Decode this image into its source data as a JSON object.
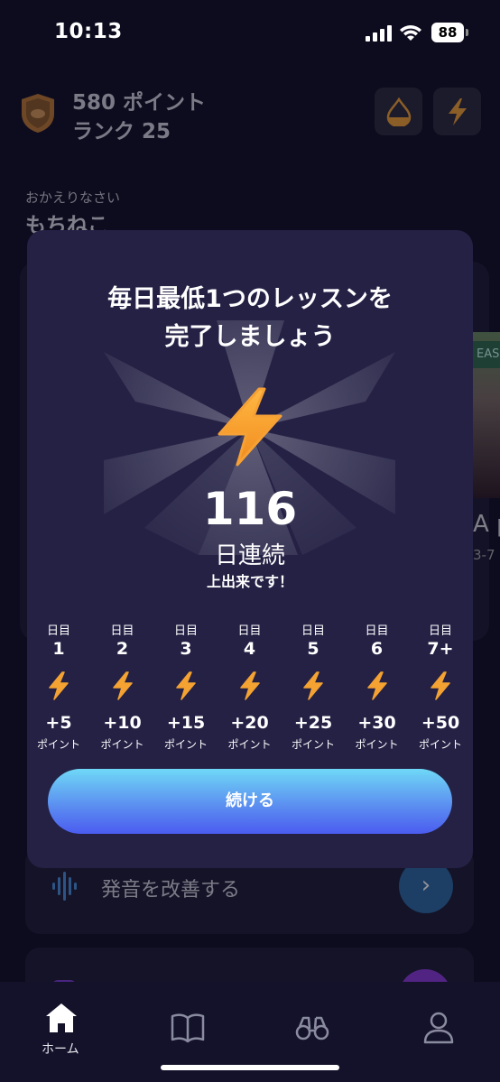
{
  "status_bar": {
    "time": "10:13",
    "battery": "88"
  },
  "header": {
    "points": "580 ポイント",
    "rank": "ランク 25"
  },
  "welcome": {
    "greeting": "おかえりなさい",
    "name": "もちねこ"
  },
  "background": {
    "peek_tag": "EAS",
    "peek_title": "A p",
    "peek_sub": "3-7",
    "improve_pronunciation": "発音を改善する",
    "arrow": "›"
  },
  "modal": {
    "title_line1": "毎日最低1つのレッスンを",
    "title_line2": "完了しましょう",
    "streak_count": "116",
    "streak_unit": "日連続",
    "streak_message": "上出来です！",
    "days": [
      {
        "label": "日目",
        "num": "1",
        "points": "+5",
        "points_label": "ポイント"
      },
      {
        "label": "日目",
        "num": "2",
        "points": "+10",
        "points_label": "ポイント"
      },
      {
        "label": "日目",
        "num": "3",
        "points": "+15",
        "points_label": "ポイント"
      },
      {
        "label": "日目",
        "num": "4",
        "points": "+20",
        "points_label": "ポイント"
      },
      {
        "label": "日目",
        "num": "5",
        "points": "+25",
        "points_label": "ポイント"
      },
      {
        "label": "日目",
        "num": "6",
        "points": "+30",
        "points_label": "ポイント"
      },
      {
        "label": "日目",
        "num": "7+",
        "points": "+50",
        "points_label": "ポイント"
      }
    ],
    "continue_label": "続ける"
  },
  "tabbar": {
    "home_label": "ホーム"
  },
  "colors": {
    "accent_orange": "#f4a232",
    "modal_bg": "#242145",
    "button_gradient_top": "#6fd8f6",
    "button_gradient_bottom": "#4b5cf0"
  }
}
